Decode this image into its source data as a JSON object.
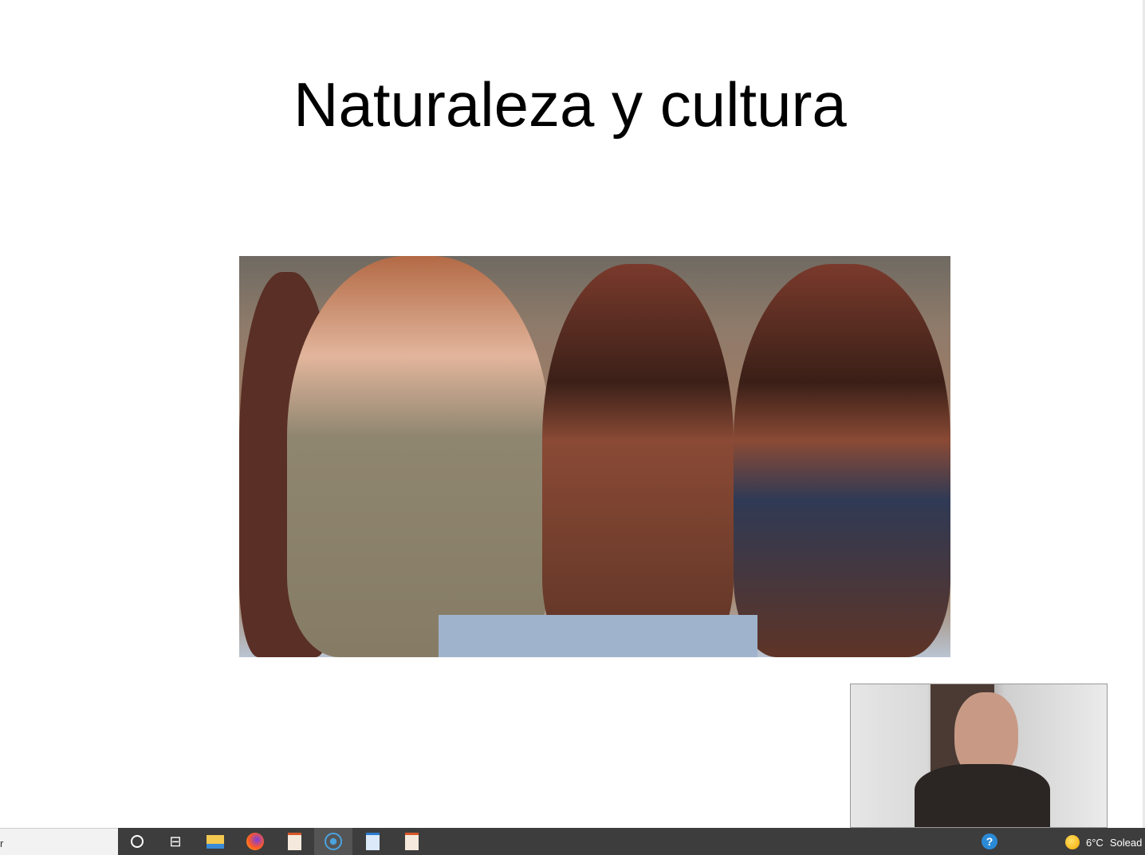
{
  "slide": {
    "title": "Naturaleza y cultura"
  },
  "taskbar": {
    "search_text": "r",
    "apps": [
      {
        "name": "cortana",
        "icon": "circle-icon"
      },
      {
        "name": "task-view",
        "icon": "task-view-icon"
      },
      {
        "name": "file-explorer",
        "icon": "folder-icon"
      },
      {
        "name": "firefox",
        "icon": "firefox-icon"
      },
      {
        "name": "impress-1",
        "icon": "presentation-icon"
      },
      {
        "name": "recorder",
        "icon": "record-icon"
      },
      {
        "name": "writer",
        "icon": "document-icon"
      },
      {
        "name": "impress-2",
        "icon": "presentation-icon"
      }
    ],
    "weather": {
      "temp": "6°C",
      "condition": "Solead"
    }
  },
  "colors": {
    "taskbar": "#3d3d3d",
    "accent": "#f5a800"
  }
}
